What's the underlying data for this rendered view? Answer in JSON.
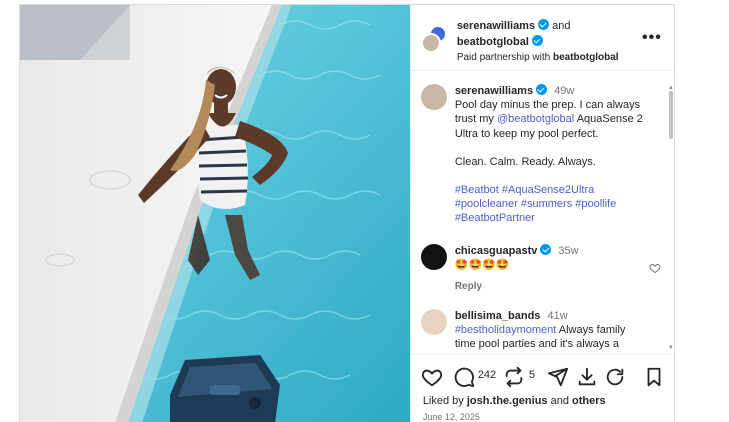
{
  "post": {
    "header": {
      "author1": "serenawilliams",
      "and_word": "and",
      "author2": "beatbotglobal",
      "partnership_prefix": "Paid partnership with",
      "partnership_brand": "beatbotglobal",
      "more_icon": "more-horizontal-icon"
    },
    "caption": {
      "username": "serenawilliams",
      "age": "49w",
      "line1": "Pool day minus the prep. I can always",
      "line2_prefix": "trust my",
      "line2_mention": "@beatbotglobal",
      "line2_suffix": "AquaSense 2",
      "line3": "Ultra to keep my pool perfect.",
      "line4": "Clean. Calm. Ready. Always.",
      "hashtags_line1": "#Beatbot #AquaSense2Ultra",
      "hashtags_line2": "#poolcleaner #summers #poollife",
      "hashtags_line3": "#BeatbotPartner"
    },
    "comments": [
      {
        "username": "chicasguapastv",
        "age": "35w",
        "text": "🤩🤩🤩🤩",
        "reply": "Reply"
      },
      {
        "username": "bellisima_bands",
        "age": "41w",
        "hashtag": "#bestholidaymoment",
        "text_after_hashtag": "Always family",
        "line2": "time pool parties and it's always a"
      }
    ],
    "actions": {
      "comment_count": "242",
      "repost_count": "5",
      "icons": [
        "heart-icon",
        "comment-icon",
        "repost-icon",
        "share-icon",
        "download-icon",
        "refresh-icon",
        "bookmark-icon"
      ]
    },
    "likes": {
      "prefix": "Liked by",
      "user": "josh.the.genius",
      "middle": "and",
      "others": "others"
    },
    "date": "June 12, 2025"
  },
  "colors": {
    "pool_water": "#5fc8dc",
    "link_blue": "#4a5fc9",
    "verified_blue": "#0095f6"
  }
}
